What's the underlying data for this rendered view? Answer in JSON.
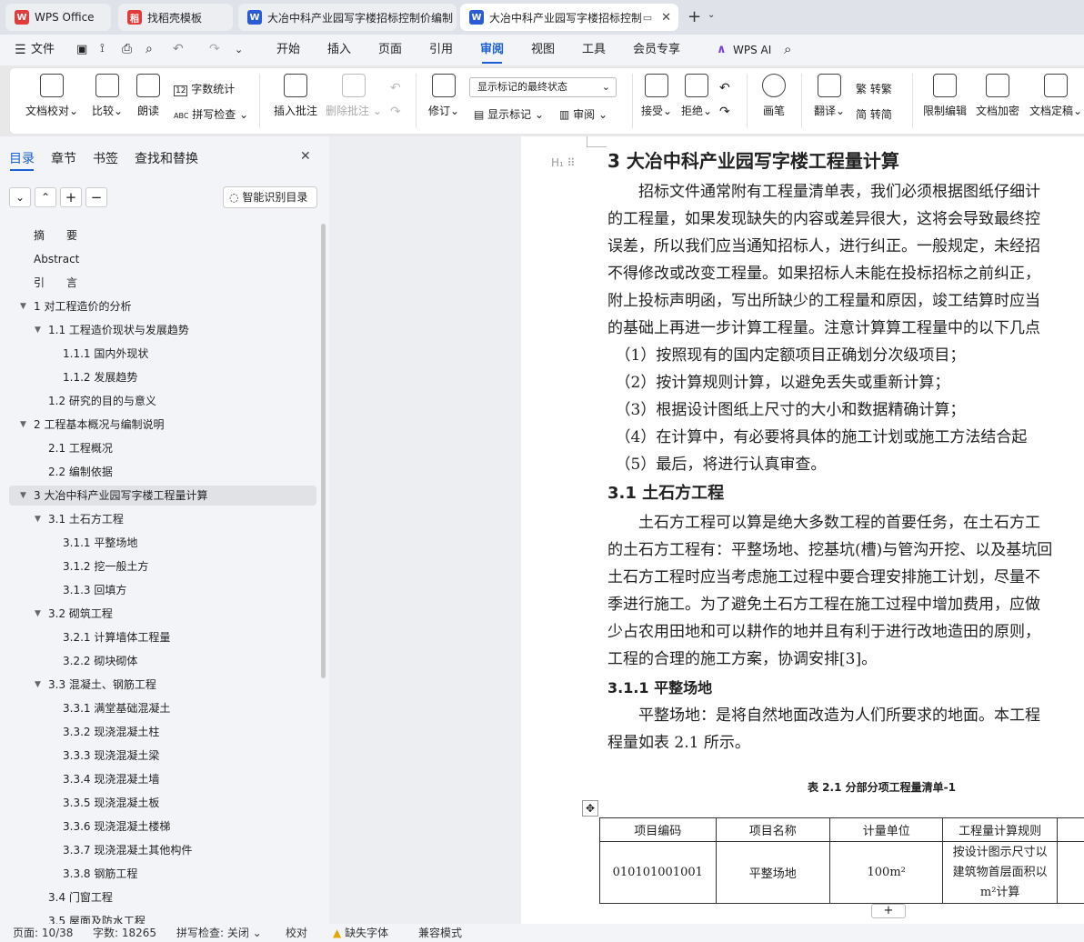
{
  "tabs": [
    {
      "label": "WPS Office",
      "color": "#e23b3b"
    },
    {
      "label": "找稻壳模板",
      "color": "#e23b3b"
    },
    {
      "label": "大冶中科产业园写字楼招标控制价编制",
      "color": "#2a5bd7"
    },
    {
      "label": "大冶中科产业园写字楼招标控制",
      "color": "#2a5bd7"
    }
  ],
  "menu": {
    "file": "文件",
    "items": [
      "开始",
      "插入",
      "页面",
      "引用",
      "审阅",
      "视图",
      "工具",
      "会员专享"
    ],
    "active": "审阅",
    "ai": "WPS AI"
  },
  "ribbon": {
    "doc_check": "文档校对",
    "compare": "比较",
    "read": "朗读",
    "word_count": "字数统计",
    "spell": "拼写检查",
    "insert_comment": "插入批注",
    "delete_comment": "删除批注",
    "revise": "修订",
    "show_mark": "显示标记",
    "review": "审阅",
    "mark_state": "显示标记的最终状态",
    "accept": "接受",
    "reject": "拒绝",
    "pen": "画笔",
    "translate": "翻译",
    "to_trad": "转繁",
    "to_simp": "转简",
    "restrict": "限制编辑",
    "encrypt": "文档加密",
    "finalize": "文档定稿"
  },
  "nav": {
    "tabs": [
      "目录",
      "章节",
      "书签",
      "查找和替换"
    ],
    "smart": "智能识别目录",
    "items": [
      {
        "text": "摘　　要",
        "level": 0
      },
      {
        "text": "Abstract",
        "level": 0
      },
      {
        "text": "引　　言",
        "level": 0
      },
      {
        "text": "1  对工程造价的分析",
        "level": 1,
        "exp": true
      },
      {
        "text": "1.1 工程造价现状与发展趋势",
        "level": 2,
        "exp": true
      },
      {
        "text": "1.1.1  国内外现状",
        "level": 3
      },
      {
        "text": "1.1.2 发展趋势",
        "level": 3
      },
      {
        "text": "1.2 研究的目的与意义",
        "level": 2
      },
      {
        "text": "2  工程基本概况与编制说明",
        "level": 1,
        "exp": true
      },
      {
        "text": "2.1  工程概况",
        "level": 2
      },
      {
        "text": "2.2  编制依据",
        "level": 2
      },
      {
        "text": "3  大冶中科产业园写字楼工程量计算",
        "level": 1,
        "exp": true,
        "sel": true
      },
      {
        "text": "3.1  土石方工程",
        "level": 2,
        "exp": true
      },
      {
        "text": "3.1.1  平整场地",
        "level": 3
      },
      {
        "text": "3.1.2  挖一般土方",
        "level": 3
      },
      {
        "text": "3.1.3  回填方",
        "level": 3
      },
      {
        "text": "3.2  砌筑工程",
        "level": 2,
        "exp": true
      },
      {
        "text": "3.2.1  计算墙体工程量",
        "level": 3
      },
      {
        "text": "3.2.2  砌块砌体",
        "level": 3
      },
      {
        "text": "3.3  混凝土、钢筋工程",
        "level": 2,
        "exp": true
      },
      {
        "text": "3.3.1  满堂基础混凝土",
        "level": 3
      },
      {
        "text": "3.3.2  现浇混凝土柱",
        "level": 3
      },
      {
        "text": "3.3.3  现浇混凝土梁",
        "level": 3
      },
      {
        "text": "3.3.4  现浇混凝土墙",
        "level": 3
      },
      {
        "text": "3.3.5  现浇混凝土板",
        "level": 3
      },
      {
        "text": "3.3.6  现浇混凝土楼梯",
        "level": 3
      },
      {
        "text": "3.3.7  现浇混凝土其他构件",
        "level": 3
      },
      {
        "text": "3.3.8  钢筋工程",
        "level": 3
      },
      {
        "text": "3.4  门窗工程",
        "level": 2
      },
      {
        "text": "3.5  屋面及防水工程",
        "level": 2
      }
    ]
  },
  "doc": {
    "lines": [
      {
        "t": "3  大冶中科产业园写字楼工程量计算",
        "k": "h1"
      },
      {
        "t": "　　招标文件通常附有工程量清单表，我们必须根据图纸仔细计",
        "k": "p"
      },
      {
        "t": "的工程量，如果发现缺失的内容或差异很大，这将会导致最终控",
        "k": "p"
      },
      {
        "t": "误差，所以我们应当通知招标人，进行纠正。一般规定，未经招",
        "k": "p"
      },
      {
        "t": "不得修改或改变工程量。如果招标人未能在投标招标之前纠正，",
        "k": "p"
      },
      {
        "t": "附上投标声明函，写出所缺少的工程量和原因，竣工结算时应当",
        "k": "p"
      },
      {
        "t": "的基础上再进一步计算工程量。注意计算算工程量中的以下几点",
        "k": "p"
      },
      {
        "t": "　（1）按照现有的国内定额项目正确划分次级项目；",
        "k": "p"
      },
      {
        "t": "　（2）按计算规则计算，以避免丢失或重新计算；",
        "k": "p"
      },
      {
        "t": "　（3）根据设计图纸上尺寸的大小和数据精确计算；",
        "k": "p"
      },
      {
        "t": "　（4）在计算中，有必要将具体的施工计划或施工方法结合起",
        "k": "p"
      },
      {
        "t": "　（5）最后，将进行认真审查。",
        "k": "p"
      },
      {
        "t": "3.1  土石方工程",
        "k": "h2"
      },
      {
        "t": "　　土石方工程可以算是绝大多数工程的首要任务，在土石方工",
        "k": "p"
      },
      {
        "t": "的土石方工程有：平整场地、挖基坑(槽)与管沟开挖、以及基坑回",
        "k": "p"
      },
      {
        "t": "土石方工程时应当考虑施工过程中要合理安排施工计划，尽量不",
        "k": "p"
      },
      {
        "t": "季进行施工。为了避免土石方工程在施工过程中增加费用，应做",
        "k": "p"
      },
      {
        "t": "少占农用田地和可以耕作的地并且有利于进行改地造田的原则，",
        "k": "p"
      },
      {
        "t": "工程的合理的施工方案，协调安排[3]。",
        "k": "p"
      },
      {
        "t": "3.1.1  平整场地",
        "k": "h3"
      },
      {
        "t": "　　平整场地：是将自然地面改造为人们所要求的地面。本工程",
        "k": "p"
      },
      {
        "t": "程量如表 2.1 所示。",
        "k": "p"
      }
    ],
    "table_title": "表 2.1  分部分项工程量清单-1",
    "table_head": [
      "项目编码",
      "项目名称",
      "计量单位",
      "工程量计算规则"
    ],
    "table_row": [
      "010101001001",
      "平整场地",
      "100m²",
      "按设计图示尺寸以建筑物首层面积以m²计算"
    ]
  },
  "status": {
    "page": "页面: 10/38",
    "words": "字数: 18265",
    "spell": "拼写检查: 关闭",
    "proof": "校对",
    "missing_font": "缺失字体",
    "compat": "兼容模式"
  }
}
